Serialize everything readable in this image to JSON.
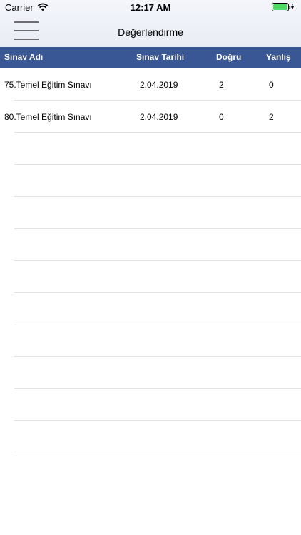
{
  "status_bar": {
    "carrier": "Carrier",
    "time": "12:17 AM",
    "battery_color": "#4cd964"
  },
  "header": {
    "title": "Değerlendirme",
    "menu_icon": "hamburger-menu-icon"
  },
  "table": {
    "header_color": "#3a5795",
    "columns": [
      "Sınav Adı",
      "Sınav Tarihi",
      "Doğru",
      "Yanlış"
    ],
    "rows": [
      {
        "name": "75.Temel Eğitim Sınavı",
        "date": "2.04.2019",
        "dogru": "2",
        "yanlis": "0"
      },
      {
        "name": "80.Temel Eğitim Sınavı",
        "date": "2.04.2019",
        "dogru": "0",
        "yanlis": "2"
      }
    ]
  }
}
